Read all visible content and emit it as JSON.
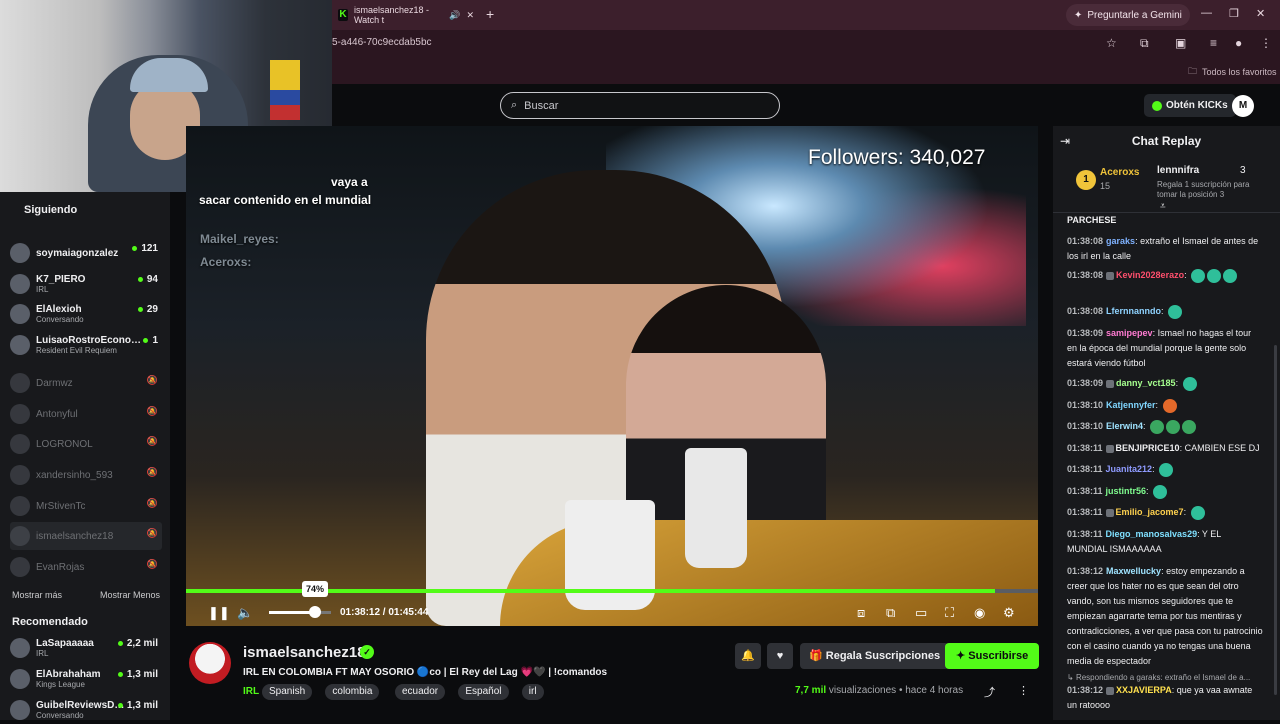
{
  "browser": {
    "tab_title": "ismaelsanchez18 - Watch t",
    "url": "5-a446-70c9ecdab5bc",
    "gemini_label": "Preguntarle a Gemini",
    "favorites_label": "Todos los favoritos"
  },
  "header": {
    "search_placeholder": "Buscar",
    "kicks_label": "Obtén KICKs",
    "avatar_initial": "M"
  },
  "sidebar": {
    "cam_overlay_label": "Siguiendo",
    "channels": [
      {
        "name": "soymaiagonzalez",
        "sub": "",
        "viewers": "121",
        "live": true
      },
      {
        "name": "K7_PIERO",
        "sub": "IRL",
        "viewers": "94",
        "live": true
      },
      {
        "name": "ElAlexioh",
        "sub": "Conversando",
        "viewers": "29",
        "live": true
      },
      {
        "name": "LuisaoRostroEconom…",
        "sub": "Resident Evil Requiem",
        "viewers": "1",
        "live": true
      },
      {
        "name": "Darmwz",
        "live": false
      },
      {
        "name": "Antonyful",
        "live": false
      },
      {
        "name": "LOGRONOL",
        "live": false
      },
      {
        "name": "xandersinho_593",
        "live": false
      },
      {
        "name": "MrStivenTc",
        "live": false
      },
      {
        "name": "ismaelsanchez18",
        "live": false
      },
      {
        "name": "EvanRojas",
        "live": false
      }
    ],
    "show_more": "Mostrar más",
    "show_less": "Mostrar Menos",
    "recommended_title": "Recomendado",
    "recommended": [
      {
        "name": "LaSapaaaaa",
        "sub": "IRL",
        "viewers": "2,2 mil"
      },
      {
        "name": "ElAbrahaham",
        "sub": "Kings League",
        "viewers": "1,3 mil"
      },
      {
        "name": "GuibelReviewsD…",
        "sub": "Conversando",
        "viewers": "1,3 mil"
      }
    ]
  },
  "video": {
    "followers_overlay": "Followers: 340,027",
    "overlay_chat_tail": "vaya a",
    "overlay_chat_text": "sacar contenido en el mundial",
    "overlay_users": [
      "Maikel_reyes:",
      "Aceroxs:"
    ],
    "volume_tooltip": "74%",
    "volume": 0.74,
    "progress": 0.95,
    "time_current": "01:38:12",
    "time_total": "01:45:44"
  },
  "info": {
    "streamer": "ismaelsanchez18",
    "title": "IRL EN COLOMBIA FT MAY OSORIO 🔵co | El Rey del Lag 💗🖤 | !comandos",
    "category": "IRL",
    "tags": [
      "Spanish",
      "colombia",
      "ecuador",
      "Español",
      "irl"
    ],
    "gift_label": "Regala Suscripciones",
    "subscribe_label": "Suscribirse",
    "views_count": "7,7 mil",
    "views_suffix": "visualizaciones",
    "ago": "• hace 4 horas"
  },
  "chat": {
    "title": "Chat Replay",
    "pinned": {
      "rank": "1",
      "user": "Aceroxs",
      "count": "15",
      "user2": "lennnifra",
      "num2": "3",
      "desc": "Regala 1 suscripción para tomar la posición 3"
    },
    "first_line": "PARCHESE",
    "messages": [
      {
        "time": "01:38:08",
        "user": "garaks",
        "color": "#7fb2ff",
        "text": "extraño el Ismael de antes de los irl en la calle"
      },
      {
        "time": "01:38:08",
        "user": "Kevin2028erazo",
        "color": "#ff4f6d",
        "text": ""
      },
      {
        "time": "01:38:08",
        "user": "Lfernnanndo",
        "color": "#8fd3ff",
        "text": ""
      },
      {
        "time": "01:38:09",
        "user": "samipepev",
        "color": "#ff7bd2",
        "text": "Ismael no hagas el tour en la época del mundial porque la gente solo estará viendo fútbol"
      },
      {
        "time": "01:38:09",
        "user": "danny_vct185",
        "color": "#a6ff8f",
        "text": ""
      },
      {
        "time": "01:38:10",
        "user": "Katjennyfer",
        "color": "#7fd6ff",
        "text": ""
      },
      {
        "time": "01:38:10",
        "user": "Elerwin4",
        "color": "#9fe3ff",
        "text": ""
      },
      {
        "time": "01:38:11",
        "user": "BENJIPRICE10",
        "color": "#efeff1",
        "text": "CAMBIEN ESE DJ"
      },
      {
        "time": "01:38:11",
        "user": "Juanita212",
        "color": "#8f9bff",
        "text": ""
      },
      {
        "time": "01:38:11",
        "user": "justintr56",
        "color": "#7ffc8f",
        "text": ""
      },
      {
        "time": "01:38:11",
        "user": "Emilio_jacome7",
        "color": "#ffd24f",
        "text": ""
      },
      {
        "time": "01:38:11",
        "user": "Diego_manosalvas29",
        "color": "#7fe0ff",
        "text": "Y EL MUNDIAL ISMAAAAAA"
      },
      {
        "time": "01:38:12",
        "user": "Maxwellucky",
        "color": "#9fe3ff",
        "text": "estoy empezando a creer que los hater no es que sean del otro vando, son tus mismos seguidores que te empiezan agarrarte tema por tus mentiras y contradicciones, a ver que pasa con tu patrocinio con el casino cuando ya no tengas una buena media de espectador"
      },
      {
        "time": "01:38:12",
        "user": "XXJAVIERPA",
        "color": "#ffe14f",
        "text": "que ya vaa awnate un ratoooo"
      }
    ],
    "reply_context": "Respondiendo a garaks: extraño el Ismael de a..."
  }
}
